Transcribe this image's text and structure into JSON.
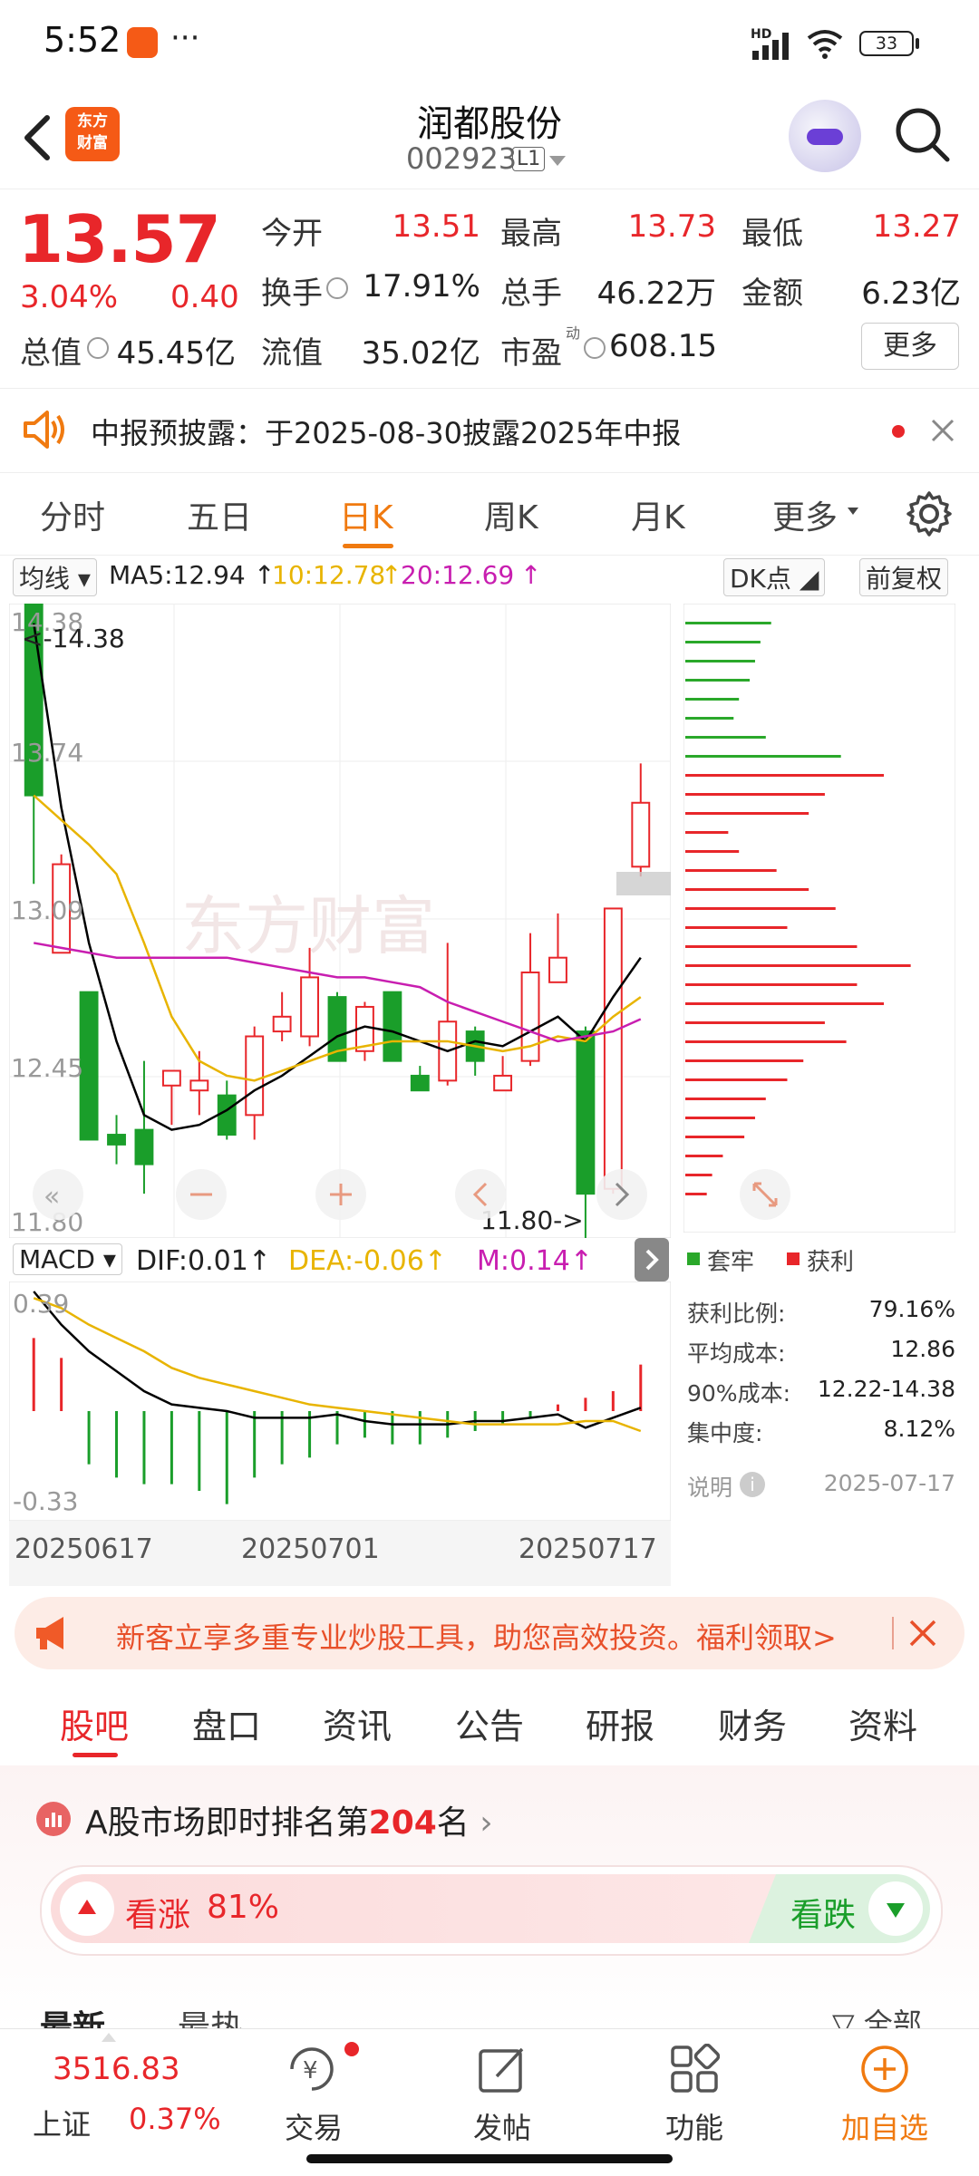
{
  "status_bar": {
    "time": "5:52",
    "dots": "···",
    "battery": "33",
    "hd": "HD"
  },
  "header": {
    "title": "润都股份",
    "code": "002923",
    "board": "L1",
    "logo_line1": "东方",
    "logo_line2": "财富"
  },
  "quote": {
    "price": "13.57",
    "change_pct": "3.04%",
    "change": "0.40",
    "rows": [
      [
        {
          "label": "今开",
          "value": "13.51",
          "color": "#e8262a"
        },
        {
          "label": "最高",
          "value": "13.73",
          "color": "#e8262a"
        },
        {
          "label": "最低",
          "value": "13.27",
          "color": "#e8262a"
        }
      ],
      [
        {
          "label": "换手",
          "value": "17.91%",
          "color": "#222222"
        },
        {
          "label": "总手",
          "value": "46.22万",
          "color": "#222222"
        },
        {
          "label": "金额",
          "value": "6.23亿",
          "color": "#222222"
        }
      ]
    ],
    "row3": {
      "total_value_label": "总值",
      "total_value": "45.45亿",
      "float_label": "流值",
      "float_value": "35.02亿",
      "pe_label": "市盈",
      "pe_sup": "动",
      "pe_value": "608.15"
    },
    "more_button": "更多"
  },
  "notice": {
    "text": "中报预披露：于2025-08-30披露2025年中报"
  },
  "period_tabs": [
    "分时",
    "五日",
    "日K",
    "周K",
    "月K",
    "更多"
  ],
  "active_period": "日K",
  "ma_line": {
    "selector": "均线",
    "ma5": "MA5:12.94",
    "ma10": "10:12.78",
    "ma20": "20:12.69",
    "dk": "DK点",
    "fq": "前复权"
  },
  "kline_labels": {
    "y_top": "14.38",
    "y_2": "13.74",
    "y_3": "13.09",
    "y_4": "12.45",
    "y_bottom": "11.80",
    "high_marker": "<-14.38",
    "low_marker": "11.80->",
    "watermark": "东方财富"
  },
  "macd_line": {
    "selector": "MACD",
    "dif": "DIF:0.01",
    "dea": "DEA:-0.06",
    "m": "M:0.14",
    "y_top": "0.39",
    "y_bottom": "-0.33"
  },
  "x_dates": [
    "20250617",
    "20250701",
    "20250717"
  ],
  "chip": {
    "legend_trapped": "套牢",
    "legend_profit": "获利",
    "rows": [
      {
        "label": "获利比例:",
        "value": "79.16%"
      },
      {
        "label": "平均成本:",
        "value": "12.86"
      },
      {
        "label": "90%成本:",
        "value": "12.22-14.38"
      },
      {
        "label": "集中度:",
        "value": "8.12%"
      }
    ],
    "note_label": "说明",
    "date": "2025-07-17"
  },
  "promo": {
    "text": "新客立享多重专业炒股工具，助您高效投资。福利领取>"
  },
  "bottom_tabs": [
    "股吧",
    "盘口",
    "资讯",
    "公告",
    "研报",
    "财务",
    "资料"
  ],
  "rank": {
    "prefix": "A股市场即时排名第",
    "rank": "204",
    "suffix": "名"
  },
  "sentiment": {
    "up_label": "看涨",
    "up_pct": "81%",
    "down_label": "看跌"
  },
  "feed_tabs": {
    "latest": "最新",
    "hot": "最热",
    "all": "全部"
  },
  "bottom_nav": {
    "index_value": "3516.83",
    "index_name": "上证",
    "index_change": "0.37%",
    "items": [
      "交易",
      "发帖",
      "功能",
      "加自选"
    ]
  },
  "colors": {
    "up": "#e8262a",
    "down": "#1a9e2a",
    "accent": "#f07a10",
    "ma5": "#000000",
    "ma10": "#e8b400",
    "ma20": "#c81eb0"
  },
  "chart_data": {
    "type": "candlestick",
    "ylim": [
      11.8,
      14.38
    ],
    "candles": [
      {
        "o": 14.38,
        "h": 14.38,
        "l": 13.24,
        "c": 13.6
      },
      {
        "o": 12.96,
        "h": 13.36,
        "l": 12.96,
        "c": 13.32
      },
      {
        "o": 12.8,
        "h": 12.8,
        "l": 12.42,
        "c": 12.2
      },
      {
        "o": 12.22,
        "h": 12.3,
        "l": 12.1,
        "c": 12.18
      },
      {
        "o": 12.24,
        "h": 12.52,
        "l": 11.98,
        "c": 12.1
      },
      {
        "o": 12.42,
        "h": 12.42,
        "l": 12.26,
        "c": 12.48
      },
      {
        "o": 12.4,
        "h": 12.56,
        "l": 12.3,
        "c": 12.44
      },
      {
        "o": 12.38,
        "h": 12.44,
        "l": 12.2,
        "c": 12.22
      },
      {
        "o": 12.3,
        "h": 12.66,
        "l": 12.2,
        "c": 12.62
      },
      {
        "o": 12.64,
        "h": 12.8,
        "l": 12.6,
        "c": 12.7
      },
      {
        "o": 12.62,
        "h": 12.98,
        "l": 12.58,
        "c": 12.86
      },
      {
        "o": 12.78,
        "h": 12.8,
        "l": 12.6,
        "c": 12.52
      },
      {
        "o": 12.56,
        "h": 12.76,
        "l": 12.52,
        "c": 12.74
      },
      {
        "o": 12.8,
        "h": 12.8,
        "l": 12.58,
        "c": 12.52
      },
      {
        "o": 12.46,
        "h": 12.5,
        "l": 12.4,
        "c": 12.4
      },
      {
        "o": 12.44,
        "h": 13.0,
        "l": 12.42,
        "c": 12.68
      },
      {
        "o": 12.64,
        "h": 12.66,
        "l": 12.46,
        "c": 12.52
      },
      {
        "o": 12.4,
        "h": 12.54,
        "l": 12.4,
        "c": 12.46
      },
      {
        "o": 12.52,
        "h": 13.04,
        "l": 12.5,
        "c": 12.88
      },
      {
        "o": 12.84,
        "h": 13.12,
        "l": 12.84,
        "c": 12.94
      },
      {
        "o": 12.64,
        "h": 12.66,
        "l": 11.8,
        "c": 11.98
      },
      {
        "o": 12.0,
        "h": 13.14,
        "l": 11.98,
        "c": 13.14
      },
      {
        "o": 13.31,
        "h": 13.73,
        "l": 13.27,
        "c": 13.57
      }
    ],
    "ma5": [
      14.3,
      13.55,
      13.0,
      12.6,
      12.3,
      12.24,
      12.26,
      12.32,
      12.4,
      12.46,
      12.54,
      12.62,
      12.66,
      12.64,
      12.6,
      12.56,
      12.6,
      12.58,
      12.64,
      12.7,
      12.6,
      12.78,
      12.94
    ],
    "ma10": [
      13.6,
      13.5,
      13.4,
      13.28,
      13.0,
      12.7,
      12.52,
      12.46,
      12.44,
      12.48,
      12.52,
      12.56,
      12.58,
      12.6,
      12.6,
      12.6,
      12.58,
      12.56,
      12.58,
      12.62,
      12.6,
      12.7,
      12.78
    ],
    "ma20": [
      13.0,
      12.98,
      12.96,
      12.94,
      12.94,
      12.94,
      12.94,
      12.94,
      12.92,
      12.9,
      12.88,
      12.86,
      12.86,
      12.84,
      12.82,
      12.76,
      12.72,
      12.68,
      12.64,
      12.6,
      12.62,
      12.64,
      12.69
    ],
    "macd": {
      "ylim": [
        -0.33,
        0.39
      ],
      "dif": [
        0.36,
        0.26,
        0.18,
        0.12,
        0.06,
        0.02,
        0.01,
        0.0,
        -0.02,
        -0.02,
        -0.02,
        -0.01,
        -0.03,
        -0.04,
        -0.04,
        -0.04,
        -0.03,
        -0.03,
        -0.02,
        -0.01,
        -0.05,
        -0.02,
        0.01
      ],
      "dea": [
        0.34,
        0.31,
        0.26,
        0.22,
        0.18,
        0.13,
        0.1,
        0.08,
        0.06,
        0.04,
        0.02,
        0.01,
        0.0,
        -0.01,
        -0.02,
        -0.03,
        -0.04,
        -0.04,
        -0.04,
        -0.04,
        -0.03,
        -0.03,
        -0.06
      ],
      "hist": [
        0.22,
        0.16,
        -0.16,
        -0.2,
        -0.22,
        -0.22,
        -0.24,
        -0.28,
        -0.2,
        -0.16,
        -0.14,
        -0.1,
        -0.08,
        -0.1,
        -0.1,
        -0.08,
        -0.06,
        -0.04,
        -0.02,
        0.02,
        0.04,
        0.06,
        0.14
      ]
    },
    "chip_profile": {
      "trapped": [
        0.32,
        0.28,
        0.26,
        0.24,
        0.2,
        0.18,
        0.3,
        0.58
      ],
      "profit": [
        0.74,
        0.52,
        0.46,
        0.16,
        0.2,
        0.34,
        0.46,
        0.56,
        0.38,
        0.64,
        0.84,
        0.64,
        0.74,
        0.52,
        0.6,
        0.44,
        0.38,
        0.3,
        0.26,
        0.22,
        0.14,
        0.1,
        0.08
      ]
    }
  }
}
